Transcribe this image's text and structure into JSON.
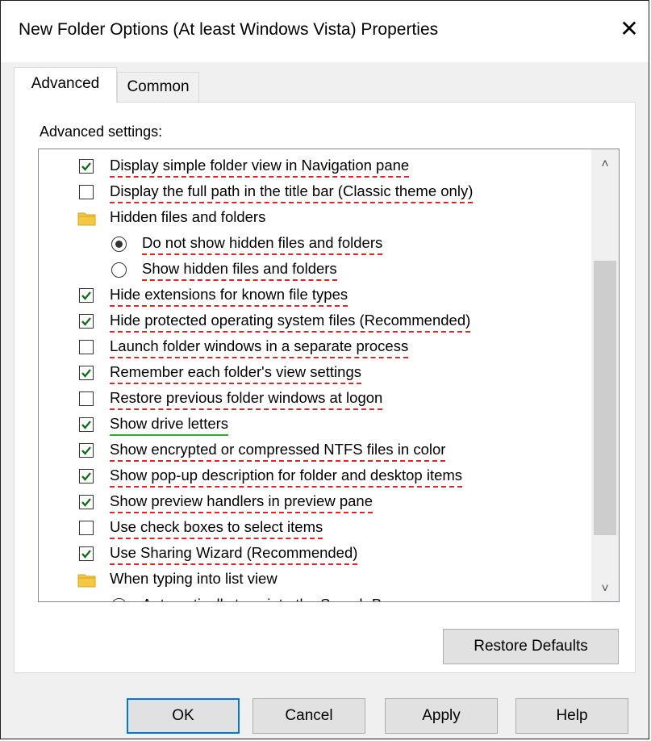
{
  "window": {
    "title": "New Folder Options (At least Windows Vista) Properties",
    "close_glyph": "✕"
  },
  "tabs": [
    {
      "label": "Advanced",
      "active": true
    },
    {
      "label": "Common",
      "active": false
    }
  ],
  "panel": {
    "heading": "Advanced settings:"
  },
  "settings": [
    {
      "kind": "checkbox",
      "checked": true,
      "label": "Display simple folder view in Navigation pane"
    },
    {
      "kind": "checkbox",
      "checked": false,
      "label": "Display the full path in the title bar (Classic theme only)"
    },
    {
      "kind": "folder",
      "label": "Hidden files and folders"
    },
    {
      "kind": "radio",
      "checked": true,
      "label": "Do not show hidden files and folders"
    },
    {
      "kind": "radio",
      "checked": false,
      "label": "Show hidden files and folders"
    },
    {
      "kind": "checkbox",
      "checked": true,
      "label": "Hide extensions for known file types"
    },
    {
      "kind": "checkbox",
      "checked": true,
      "label": "Hide protected operating system files (Recommended)"
    },
    {
      "kind": "checkbox",
      "checked": false,
      "label": "Launch folder windows in a separate process"
    },
    {
      "kind": "checkbox",
      "checked": true,
      "label": "Remember each folder's view settings"
    },
    {
      "kind": "checkbox",
      "checked": false,
      "label": "Restore previous folder windows at logon"
    },
    {
      "kind": "checkbox",
      "checked": true,
      "label": "Show drive letters"
    },
    {
      "kind": "checkbox",
      "checked": true,
      "label": "Show encrypted or compressed NTFS files in color"
    },
    {
      "kind": "checkbox",
      "checked": true,
      "label": "Show pop-up description for folder and desktop items"
    },
    {
      "kind": "checkbox",
      "checked": true,
      "label": "Show preview handlers in preview pane"
    },
    {
      "kind": "checkbox",
      "checked": false,
      "label": "Use check boxes to select items"
    },
    {
      "kind": "checkbox",
      "checked": true,
      "label": "Use Sharing Wizard (Recommended)"
    },
    {
      "kind": "folder",
      "label": "When typing into list view"
    },
    {
      "kind": "radio",
      "checked": false,
      "label": "Automatically type into the Search Box"
    }
  ],
  "scrollbar": {
    "up_glyph": "˄",
    "down_glyph": "˅"
  },
  "buttons": {
    "restore_defaults": "Restore Defaults",
    "ok": "OK",
    "cancel": "Cancel",
    "apply": "Apply",
    "help": "Help"
  },
  "colors": {
    "checkmark": "#0a6e0a",
    "folder": "#f5c842",
    "folder_dark": "#d9a520",
    "underline_red": "#d92626",
    "underline_green": "#26b326",
    "default_button_border": "#0078d7"
  }
}
